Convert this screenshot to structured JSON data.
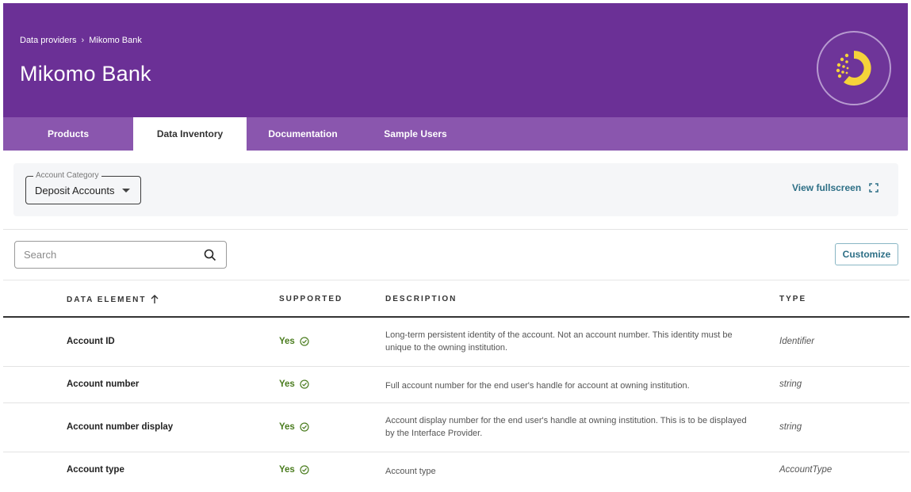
{
  "header": {
    "breadcrumb": [
      "Data providers",
      "Mikomo Bank"
    ],
    "title": "Mikomo Bank",
    "colors": {
      "header_bg": "#6b3096",
      "tabs_bg": "#8a56ae",
      "logo_accent": "#f5d33a"
    }
  },
  "tabs": [
    {
      "label": "Products",
      "active": false
    },
    {
      "label": "Data Inventory",
      "active": true
    },
    {
      "label": "Documentation",
      "active": false
    },
    {
      "label": "Sample Users",
      "active": false
    }
  ],
  "filter": {
    "label": "Account Category",
    "value": "Deposit Accounts",
    "view_fullscreen": "View fullscreen"
  },
  "search": {
    "placeholder": "Search",
    "value": ""
  },
  "customize_label": "Customize",
  "table": {
    "columns": [
      "DATA ELEMENT",
      "SUPPORTED",
      "DESCRIPTION",
      "TYPE"
    ],
    "sort_column": "DATA ELEMENT",
    "sort_direction": "ascending",
    "rows": [
      {
        "name": "Account ID",
        "supported": "Yes",
        "description": "Long-term persistent identity of the account. Not an account number. This identity must be unique to the owning institution.",
        "type": "Identifier"
      },
      {
        "name": "Account number",
        "supported": "Yes",
        "description": "Full account number for the end user's handle for account at owning institution.",
        "type": "string"
      },
      {
        "name": "Account number display",
        "supported": "Yes",
        "description": "Account display number for the end user's handle at owning institution. This is to be displayed by the Interface Provider.",
        "type": "string"
      },
      {
        "name": "Account type",
        "supported": "Yes",
        "description": "Account type",
        "type": "AccountType"
      }
    ]
  }
}
